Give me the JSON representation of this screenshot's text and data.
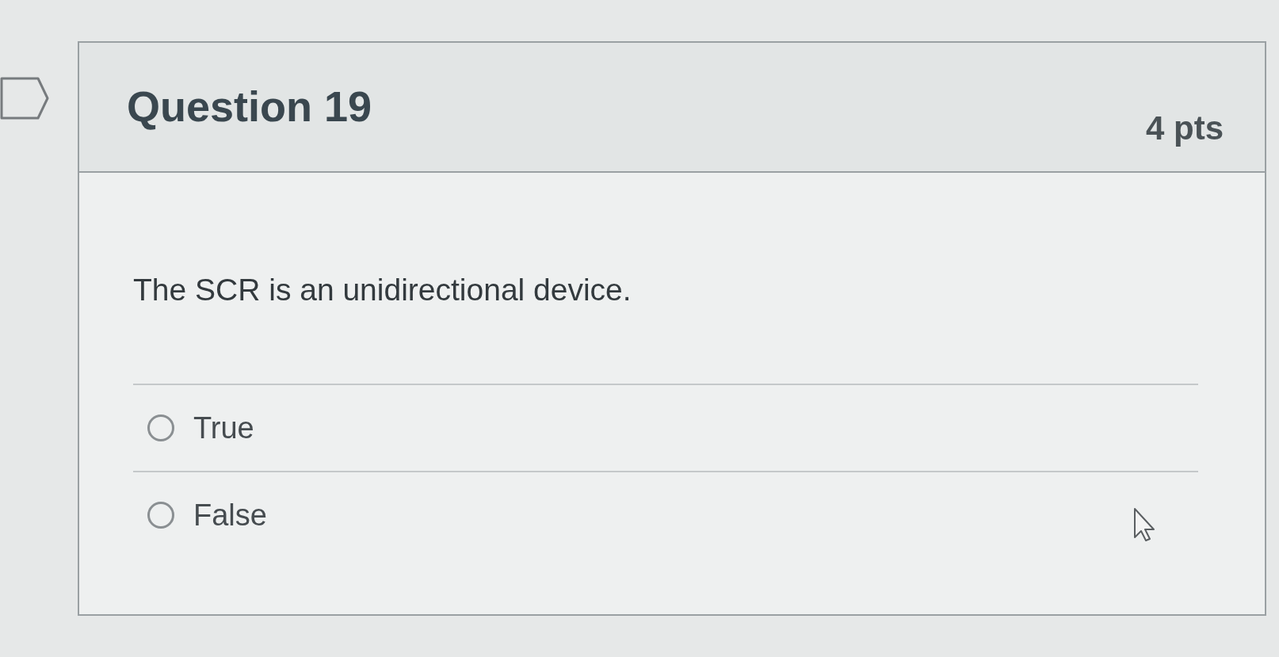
{
  "flag": {
    "flagged": false
  },
  "question": {
    "title": "Question 19",
    "points": "4 pts",
    "text": "The SCR is an unidirectional device.",
    "answers": [
      {
        "label": "True",
        "selected": false
      },
      {
        "label": "False",
        "selected": false
      }
    ]
  }
}
